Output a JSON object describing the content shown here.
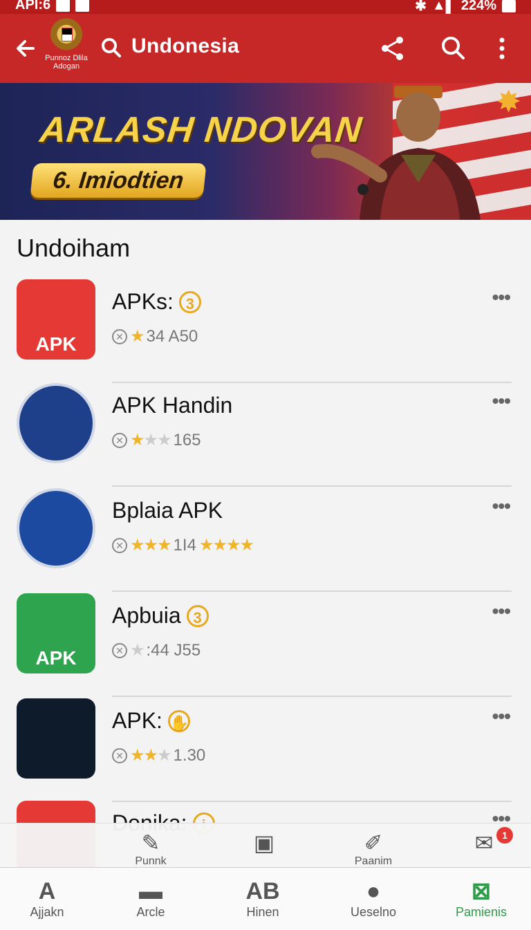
{
  "statusbar": {
    "time": "API:6",
    "battery": "224%"
  },
  "appbar": {
    "emblem_caption_1": "Punnoz Dlila",
    "emblem_caption_2": "Adogan",
    "title": "Undonesia"
  },
  "banner": {
    "headline": "ARLASH NDOVAN",
    "pill": "6. Imiodtien"
  },
  "section": {
    "title": "Undoiham"
  },
  "apps": [
    {
      "name": "APKs:",
      "badge": "3",
      "meta": "34 A50",
      "stars": "★",
      "stars_off": "",
      "icon_text": "APK",
      "color": "#e53935"
    },
    {
      "name": "APK Handin",
      "badge": "",
      "meta": "165",
      "stars": "★",
      "stars_off": "★★",
      "icon_text": "",
      "color": "#1e3f8a"
    },
    {
      "name": "Bplaia APK",
      "badge": "",
      "meta": "1I4",
      "stars": "★★★",
      "stars_off": "",
      "tail_stars": "★★★★",
      "icon_text": "",
      "color": "#1c4aa0"
    },
    {
      "name": "Apbuia",
      "badge": "3",
      "meta": ":44 J55",
      "stars": "",
      "stars_off": "★",
      "icon_text": "APK",
      "color": "#2ea44f"
    },
    {
      "name": "APK:",
      "badge": "✋",
      "meta": "1.30",
      "stars": "★★",
      "stars_off": "★",
      "icon_text": "",
      "color": "#0d1b2a"
    },
    {
      "name": "Donika:",
      "badge": "i",
      "meta": "",
      "stars": "",
      "stars_off": "",
      "icon_text": "",
      "color": "#e53935"
    }
  ],
  "subbar": {
    "item1": "Punnk",
    "item3": "Paanim",
    "notif": "1"
  },
  "bottomnav": {
    "item1": "Ajjakn",
    "item2": "Arcle",
    "item3": "Hinen",
    "item4": "Ueselno",
    "item5": "Pamienis"
  },
  "colors": {
    "appbar": "#c62828",
    "active": "#2e9b48",
    "star": "#f0b429"
  }
}
